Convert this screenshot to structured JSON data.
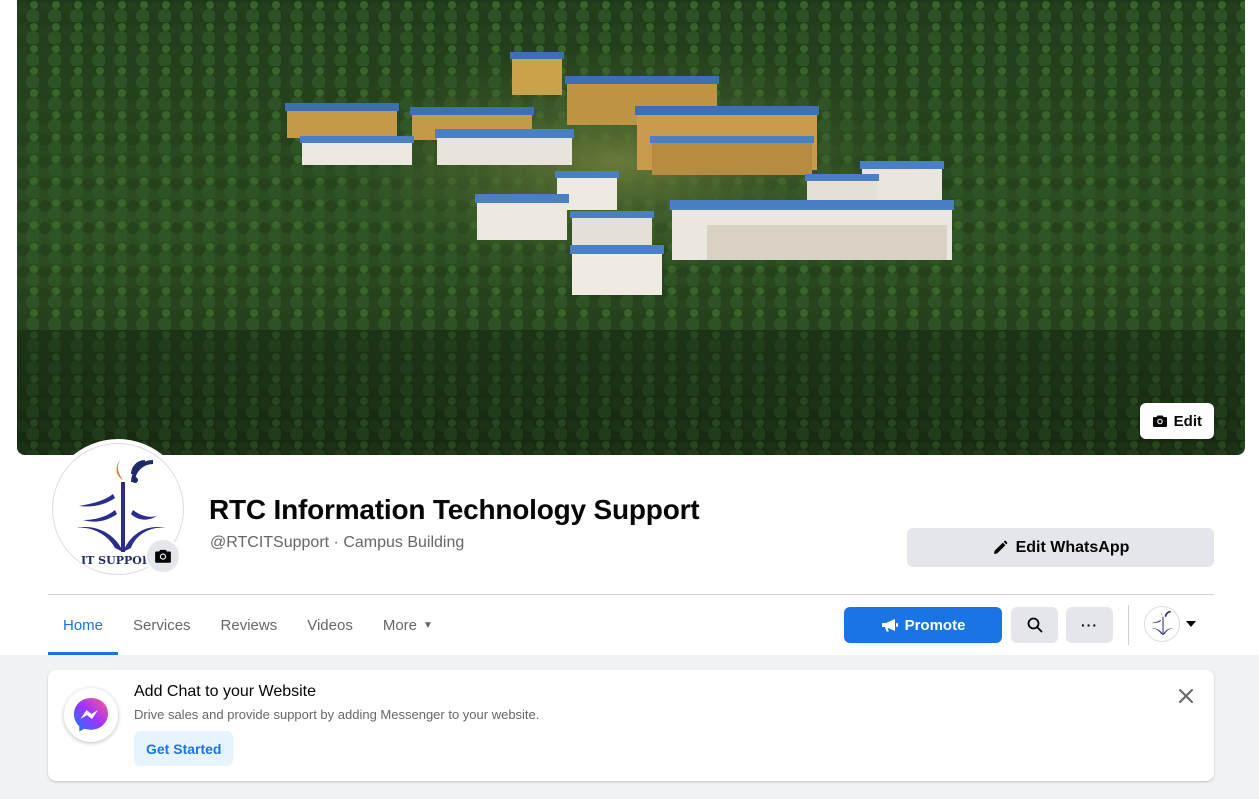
{
  "cover": {
    "edit_label": "Edit"
  },
  "profile": {
    "logo_text": "IT SUPPORT",
    "name": "RTC Information Technology Support",
    "subtitle": "@RTCITSupport · Campus Building",
    "edit_whatsapp_label": "Edit WhatsApp"
  },
  "nav": {
    "tabs": [
      {
        "label": "Home",
        "active": true
      },
      {
        "label": "Services",
        "active": false
      },
      {
        "label": "Reviews",
        "active": false
      },
      {
        "label": "Videos",
        "active": false
      },
      {
        "label": "More",
        "active": false
      }
    ],
    "promote_label": "Promote",
    "more_dots": "···"
  },
  "chat_card": {
    "title": "Add Chat to your Website",
    "description": "Drive sales and provide support by adding Messenger to your website.",
    "cta": "Get Started"
  },
  "colors": {
    "accent": "#1b74e4",
    "button_grey": "#e4e6eb",
    "page_bg": "#f0f2f5",
    "logo_navy": "#2b2d8c"
  }
}
